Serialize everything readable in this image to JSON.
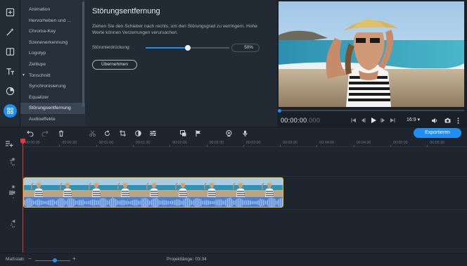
{
  "categories": [
    {
      "label": "Animation"
    },
    {
      "label": "Hervorheben und ..."
    },
    {
      "label": "Chroma-Key"
    },
    {
      "label": "Szenenerkennung"
    },
    {
      "label": "Logotyp"
    },
    {
      "label": "Zeitlupe"
    },
    {
      "label": "Tonschnitt"
    },
    {
      "label": "Synchronisierung"
    },
    {
      "label": "Equalizer"
    },
    {
      "label": "Störungsentfernung"
    },
    {
      "label": "Audioeffekte"
    }
  ],
  "panel": {
    "title": "Störungsentfernung",
    "description": "Ziehen Sie den Schieber nach rechts, um den Störungsgrad zu verringern. Hohe Werte können Verzerrungen verursachen.",
    "slider_label": "Störunterdrückung:",
    "slider_value": "50%",
    "slider_level": 0.5,
    "apply_label": "Übernehmen"
  },
  "player": {
    "time_main": "00:00:00",
    "time_frac": ".000",
    "aspect_ratio": "16:9 ▾",
    "progress": 0.0
  },
  "toolbar": {
    "export_label": "Exportieren"
  },
  "ruler": {
    "ticks": [
      "00:00:00",
      "00:00:30",
      "00:01:00",
      "00:01:30",
      "00:02:00",
      "00:02:30",
      "00:03:00",
      "00:03:30",
      "00:04:00",
      "00:04:30",
      "00:05:00",
      "00:05:30"
    ]
  },
  "status": {
    "scale_label": "Maßstab:",
    "project_length": "Projektlänge:  03:34"
  },
  "colors": {
    "accent": "#1f8ef1",
    "clip_border": "#f5c518",
    "playhead": "#e53935"
  }
}
